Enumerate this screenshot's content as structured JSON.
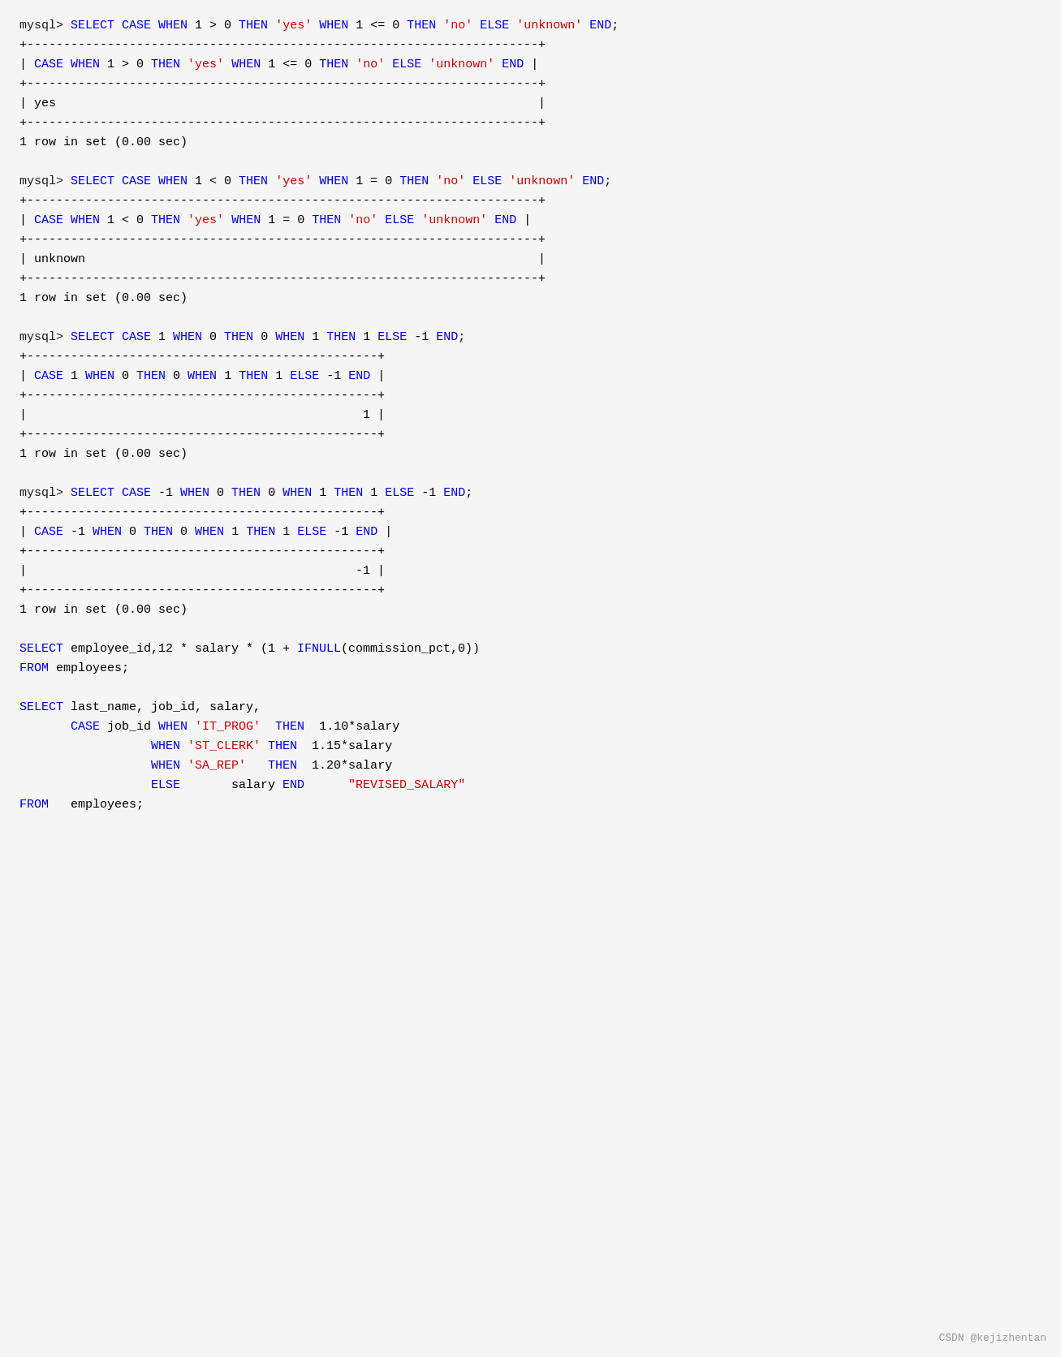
{
  "terminal": {
    "blocks": [
      {
        "id": "block1",
        "lines": [
          {
            "type": "command",
            "text": "mysql> SELECT CASE WHEN 1 > 0 THEN 'yes' WHEN 1 <= 0 THEN 'no' ELSE 'unknown' END;"
          },
          {
            "type": "border",
            "text": "+----------------------------------------------------------------------+"
          },
          {
            "type": "header",
            "text": "| CASE WHEN 1 > 0 THEN 'yes' WHEN 1 <= 0 THEN 'no' ELSE 'unknown' END |"
          },
          {
            "type": "border",
            "text": "+----------------------------------------------------------------------+"
          },
          {
            "type": "data",
            "text": "| yes                                                                  |"
          },
          {
            "type": "border",
            "text": "+----------------------------------------------------------------------+"
          },
          {
            "type": "info",
            "text": "1 row in set (0.00 sec)"
          }
        ]
      },
      {
        "id": "block2",
        "lines": [
          {
            "type": "command",
            "text": "mysql> SELECT CASE WHEN 1 < 0 THEN 'yes' WHEN 1 = 0 THEN 'no' ELSE 'unknown' END;"
          },
          {
            "type": "border",
            "text": "+----------------------------------------------------------------------+"
          },
          {
            "type": "header",
            "text": "| CASE WHEN 1 < 0 THEN 'yes' WHEN 1 = 0 THEN 'no' ELSE 'unknown' END |"
          },
          {
            "type": "border",
            "text": "+----------------------------------------------------------------------+"
          },
          {
            "type": "data",
            "text": "| unknown                                                              |"
          },
          {
            "type": "border",
            "text": "+----------------------------------------------------------------------+"
          },
          {
            "type": "info",
            "text": "1 row in set (0.00 sec)"
          }
        ]
      },
      {
        "id": "block3",
        "lines": [
          {
            "type": "command",
            "text": "mysql> SELECT CASE 1 WHEN 0 THEN 0 WHEN 1 THEN 1 ELSE -1 END;"
          },
          {
            "type": "border",
            "text": "+------------------------------------------------+"
          },
          {
            "type": "header",
            "text": "| CASE 1 WHEN 0 THEN 0 WHEN 1 THEN 1 ELSE -1 END |"
          },
          {
            "type": "border",
            "text": "+------------------------------------------------+"
          },
          {
            "type": "data",
            "text": "|                                              1 |"
          },
          {
            "type": "border",
            "text": "+------------------------------------------------+"
          },
          {
            "type": "info",
            "text": "1 row in set (0.00 sec)"
          }
        ]
      },
      {
        "id": "block4",
        "lines": [
          {
            "type": "command",
            "text": "mysql> SELECT CASE -1 WHEN 0 THEN 0 WHEN 1 THEN 1 ELSE -1 END;"
          },
          {
            "type": "border",
            "text": "+------------------------------------------------+"
          },
          {
            "type": "header",
            "text": "| CASE -1 WHEN 0 THEN 0 WHEN 1 THEN 1 ELSE -1 END |"
          },
          {
            "type": "border",
            "text": "+------------------------------------------------+"
          },
          {
            "type": "data",
            "text": "|                                             -1 |"
          },
          {
            "type": "border",
            "text": "+------------------------------------------------+"
          },
          {
            "type": "info",
            "text": "1 row in set (0.00 sec)"
          }
        ]
      },
      {
        "id": "block5",
        "lines": [
          {
            "type": "code",
            "text": "SELECT employee_id,12 * salary * (1 + IFNULL(commission_pct,0))"
          },
          {
            "type": "code",
            "text": "FROM employees;"
          }
        ]
      },
      {
        "id": "block6",
        "lines": [
          {
            "type": "code2",
            "text": "SELECT last_name, job_id, salary,"
          },
          {
            "type": "code2",
            "text": "       CASE job_id WHEN 'IT_PROG'  THEN  1.10*salary"
          },
          {
            "type": "code2",
            "text": "                  WHEN 'ST_CLERK' THEN  1.15*salary"
          },
          {
            "type": "code2",
            "text": "                  WHEN 'SA_REP'   THEN  1.20*salary"
          },
          {
            "type": "code2",
            "text": "                  ELSE       salary END      \"REVISED_SALARY\""
          },
          {
            "type": "code2",
            "text": "FROM   employees;"
          }
        ]
      }
    ],
    "watermark": "CSDN @kejizhentan"
  }
}
